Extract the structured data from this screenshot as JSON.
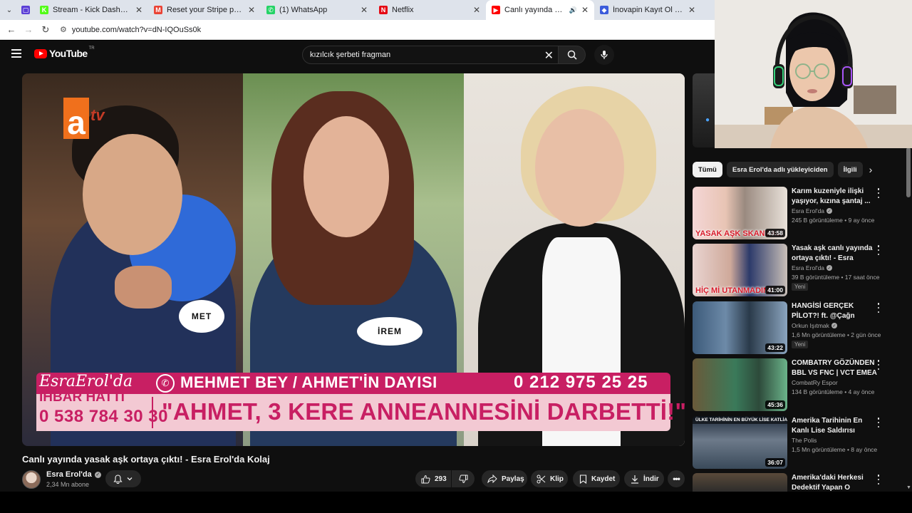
{
  "browser": {
    "tabs": [
      {
        "title": "Stream - Kick Dashboard",
        "favicon_color": "#53fc18",
        "favicon_glyph": "K"
      },
      {
        "title": "Reset your Stripe password - n",
        "favicon_color": "#ea4335",
        "favicon_glyph": "M"
      },
      {
        "title": "(1) WhatsApp",
        "favicon_color": "#25d366",
        "favicon_glyph": "✆"
      },
      {
        "title": "Netflix",
        "favicon_color": "#e50914",
        "favicon_glyph": "N"
      },
      {
        "title": "Canlı yayında yasak aşk orta",
        "favicon_color": "#ff0000",
        "favicon_glyph": "▶",
        "active": true
      },
      {
        "title": "İnovapin Kayıt Ol | Hemen Üye",
        "favicon_color": "#3b5bdb",
        "favicon_glyph": "◆"
      }
    ],
    "url": "youtube.com/watch?v=dN-IQOuSs0k"
  },
  "youtube": {
    "logo_text": "YouTube",
    "country_code": "TR",
    "search": {
      "value": "kızılcık şerbeti fragman",
      "clear_icon": "close-icon",
      "search_icon": "search-icon",
      "mic_icon": "mic-icon"
    }
  },
  "video": {
    "title": "Canlı yayında yasak aşk ortaya çıktı! - Esra Erol'da Kolaj",
    "overlay": {
      "channel_logo": "a tv",
      "name_tag_left": "MET",
      "name_tag_center": "İREM",
      "banner_logo": "EsraErol'da",
      "hotline_label": "İHBAR HATTI",
      "hotline_number": "0 538 784 30 30",
      "caller": "MEHMET BEY / AHMET'İN DAYISI",
      "caller_phone": "0 212 975 25 25",
      "quote": "\"AHMET, 3 KERE ANNEANNESİNİ DARBETTİ!\""
    },
    "channel": {
      "name": "Esra Erol'da",
      "subscribers": "2,34 Mn abone"
    },
    "actions": {
      "likes": "293",
      "share": "Paylaş",
      "clip": "Klip",
      "save": "Kaydet",
      "download": "İndir"
    }
  },
  "sidebar": {
    "chips": [
      {
        "label": "Tümü",
        "active": true
      },
      {
        "label": "Esra Erol'da adlı yükleyiciden",
        "active": false
      },
      {
        "label": "İlgili",
        "active": false
      }
    ],
    "recommendations": [
      {
        "title": "Karım kuzeniyle ilişki yaşıyor, kızına şantaj ...",
        "channel": "Esra Erol'da",
        "verified": true,
        "meta": "245 B görüntüleme • 9 ay önce",
        "duration": "43:58",
        "thumb_text": "YASAK AŞK SKANDALI",
        "thumb_text_color": "#d81b2a",
        "new": ""
      },
      {
        "title": "Yasak aşk canlı yayında ortaya çıktı! - Esra Erol'da...",
        "channel": "Esra Erol'da",
        "verified": true,
        "meta": "39 B görüntüleme • 17 saat önce",
        "duration": "41:00",
        "thumb_text": "HİÇ Mİ UTANMADIN?",
        "thumb_text_color": "#d81b2a",
        "new": "Yeni"
      },
      {
        "title": "HANGİSİ GERÇEK PİLOT?! ft. @Çağn Ergün",
        "channel": "Orkun Işıtmak",
        "verified": true,
        "meta": "1,6 Mn görüntüleme • 2 gün önce",
        "duration": "43:22",
        "thumb_text": "",
        "thumb_text_color": "#ffffff",
        "new": "Yeni"
      },
      {
        "title": "COMBATRY GÖZÜNDEN BBL VS FNC | VCT EMEA ...",
        "channel": "CombatRy Espor",
        "verified": false,
        "meta": "134 B görüntüleme • 4 ay önce",
        "duration": "45:36",
        "thumb_text": "",
        "thumb_text_color": "#ffffff",
        "new": ""
      },
      {
        "title": "Amerika Tarihinin En Kanlı Lise Saldırısı",
        "channel": "The Polis",
        "verified": false,
        "meta": "1,5 Mn görüntüleme • 8 ay önce",
        "duration": "36:07",
        "thumb_text": "ÜLKE TARİHİNİN EN BÜYÜK LİSE KATLİAMI",
        "thumb_text_color": "#ffffff",
        "new": ""
      },
      {
        "title": "Amerika'daki Herkesi Dedektif Yapan O Cinayet",
        "channel": "",
        "verified": false,
        "meta": "",
        "duration": "",
        "thumb_text": "",
        "thumb_text_color": "#ffffff",
        "new": ""
      }
    ]
  },
  "colors": {
    "youtube_red": "#ff0000",
    "esra_pink": "#c81f63",
    "yt_bg": "#0f0f0f"
  }
}
